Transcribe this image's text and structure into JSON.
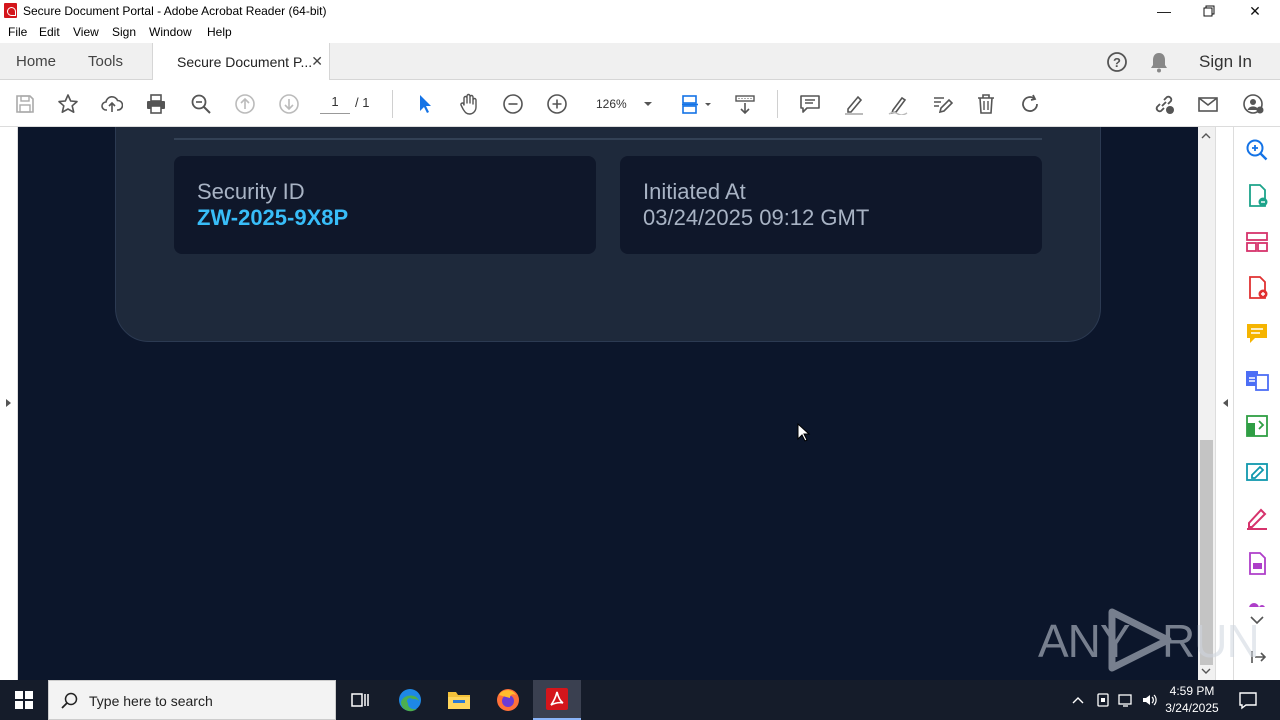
{
  "window": {
    "title": "Secure Document Portal - Adobe Acrobat Reader (64-bit)",
    "minimize": "—",
    "restore": "❐",
    "close": "✕"
  },
  "menu": [
    "File",
    "Edit",
    "View",
    "Sign",
    "Window",
    "Help"
  ],
  "tabs": {
    "home": "Home",
    "tools": "Tools",
    "document": "Secure Document P...",
    "close": "✕",
    "sign_in": "Sign In"
  },
  "toolbar": {
    "page_current": "1",
    "page_total": "/  1",
    "zoom": "126%"
  },
  "document": {
    "security_id_label": "Security ID",
    "security_id_value": "ZW-2025-9X8P",
    "initiated_label": "Initiated At",
    "initiated_value": "03/24/2025 09:12 GMT"
  },
  "colors": {
    "accent_blue": "#38bdf8",
    "value_text": "#a8b3c4",
    "doc_bg": "#0c162b",
    "card_bg": "#1e293b",
    "box_bg": "#0f172a"
  },
  "watermark": {
    "left": "ANY",
    "right": "RUN"
  },
  "taskbar": {
    "search_placeholder": "Type here to search",
    "time": "4:59 PM",
    "date": "3/24/2025"
  }
}
